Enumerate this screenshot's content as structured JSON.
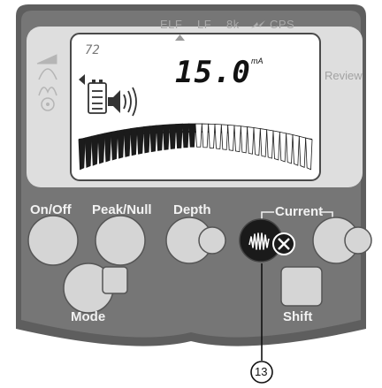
{
  "frequency_labels": [
    "ELF",
    "LF",
    "8k",
    "CPS"
  ],
  "review_label": "Review",
  "lcd": {
    "reading_value": "15.0",
    "reading_unit": "mA",
    "volume_value": "72",
    "signal_level_fraction": 0.5
  },
  "mode_icons": [
    "broad-mode-icon",
    "peak-mode-icon",
    "null-mode-icon",
    "antenna-mode-icon"
  ],
  "buttons": {
    "on_off": "On/Off",
    "peak_null": "Peak/Null",
    "depth": "Depth",
    "current": "Current",
    "mode": "Mode",
    "shift": "Shift"
  },
  "callout_number": "13",
  "colors": {
    "panel_outer": "#5b5b5b",
    "panel_inner": "#737373",
    "lcd_background": "#ffffff",
    "key_face": "#d4d4d4",
    "highlight_key": "#1a1a1a"
  }
}
